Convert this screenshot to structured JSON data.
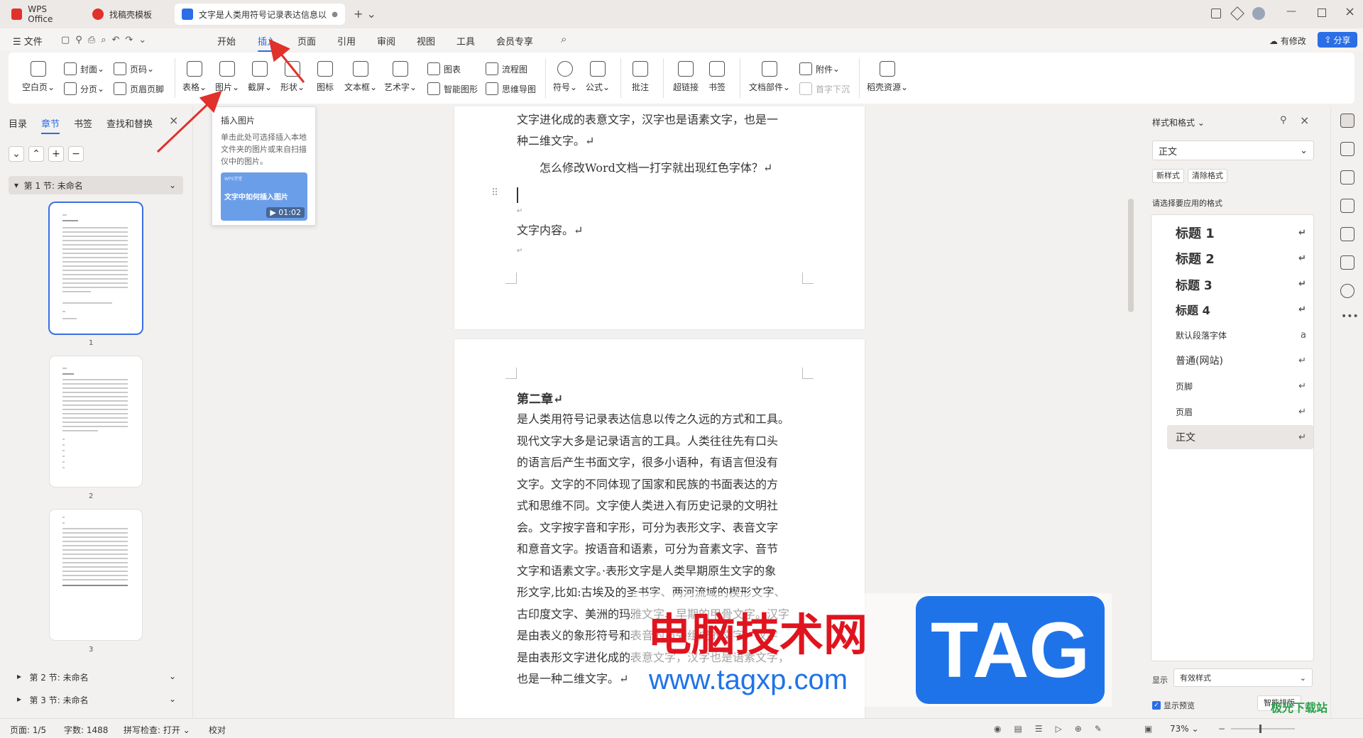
{
  "tabs": [
    {
      "label": "WPS Office"
    },
    {
      "label": "找稿壳模板"
    },
    {
      "label": "文字是人类用符号记录表达信息以"
    }
  ],
  "menu": {
    "file": "文件",
    "items": [
      "开始",
      "插入",
      "页面",
      "引用",
      "审阅",
      "视图",
      "工具",
      "会员专享"
    ],
    "active": "插入",
    "has_changes": "有修改",
    "share": "分享"
  },
  "ribbon": {
    "blank_page": "空白页",
    "cover": "封面",
    "page_break": "分页",
    "page_number": "页码",
    "header_footer": "页眉页脚",
    "table": "表格",
    "picture": "图片",
    "screenshot": "截屏",
    "shape": "形状",
    "icon": "图标",
    "textbox": "文本框",
    "wordart": "艺术字",
    "chart": "图表",
    "smartart": "智能图形",
    "flowchart": "流程图",
    "mindmap": "思维导图",
    "symbol": "符号",
    "formula": "公式",
    "comment": "批注",
    "hyperlink": "超链接",
    "bookmark": "书签",
    "doc_parts": "文档部件",
    "attachment": "附件",
    "drop_cap": "首字下沉",
    "resources": "稻壳资源"
  },
  "left_panel": {
    "tabs": [
      "目录",
      "章节",
      "书签",
      "查找和替换"
    ],
    "active_tab": "章节",
    "section1": "第 1 节: 未命名",
    "section2": "第 2 节: 未命名",
    "section3": "第 3 节: 未命名",
    "page_numbers": [
      "1",
      "2",
      "3"
    ]
  },
  "tooltip": {
    "title": "插入图片",
    "desc": "单击此处可选择插入本地文件夹的图片或来自扫描仪中的图片。",
    "video_badge": "WPS学堂",
    "video_title": "文字中如何插入图片",
    "video_time": "01:02"
  },
  "document": {
    "p1_line1": "文字进化成的表意文字，汉字也是语素文字，也是一",
    "p1_line2": "种二维文字。↵",
    "question": "怎么修改Word文档一打字就出现红色字体？↵",
    "content_label": "文字内容。↵",
    "chapter2": "第二章↵",
    "body_lines": [
      "是人类用符号记录表达信息以传之久远的方式和工具。",
      "现代文字大多是记录语言的工具。人类往往先有口头",
      "的语言后产生书面文字，很多小语种，有语言但没有",
      "文字。文字的不同体现了国家和民族的书面表达的方",
      "式和思维不同。文字使人类进入有历史记录的文明社",
      "会。文字按字音和字形，可分为表形文字、表音文字",
      "和意音文字。按语音和语素，可分为音素文字、音节",
      "文字和语素文字。·表形文字是人类早期原生文字的象",
      "形文字,比如:古埃及的圣书字、两河流域的楔形文字、",
      "古印度文字、美洲的玛雅文字、早期的甲骨文字。汉字",
      "是由表义的象形符号和表音的声旁组成的文字，汉字",
      "是由表形文字进化成的表意文字，汉字也是语素文字，",
      "也是一种二维文字。↵"
    ]
  },
  "right_panel": {
    "title": "样式和格式",
    "current_style": "正文",
    "new_style": "新样式",
    "clear_format": "清除格式",
    "hint": "请选择要应用的格式",
    "styles": [
      "标题 1",
      "标题 2",
      "标题 3",
      "标题 4",
      "默认段落字体",
      "普通(网站)",
      "页脚",
      "页眉",
      "正文"
    ],
    "show_label": "显示",
    "show_value": "有效样式",
    "preview_label": "显示预览",
    "smart_layout": "智能排版"
  },
  "status": {
    "page": "页面: 1/5",
    "words": "字数: 1488",
    "spell": "拼写检查: 打开",
    "proof": "校对",
    "zoom": "73%"
  },
  "watermark": {
    "cn": "电脑技术网",
    "url": "www.tagxp.com",
    "tag": "TAG",
    "corner": "极光下载站"
  },
  "colors": {
    "accent": "#2b6ee6",
    "arrow": "#e0312b",
    "tag_blue": "#1f73e8",
    "watermark_red": "#e0141e"
  }
}
